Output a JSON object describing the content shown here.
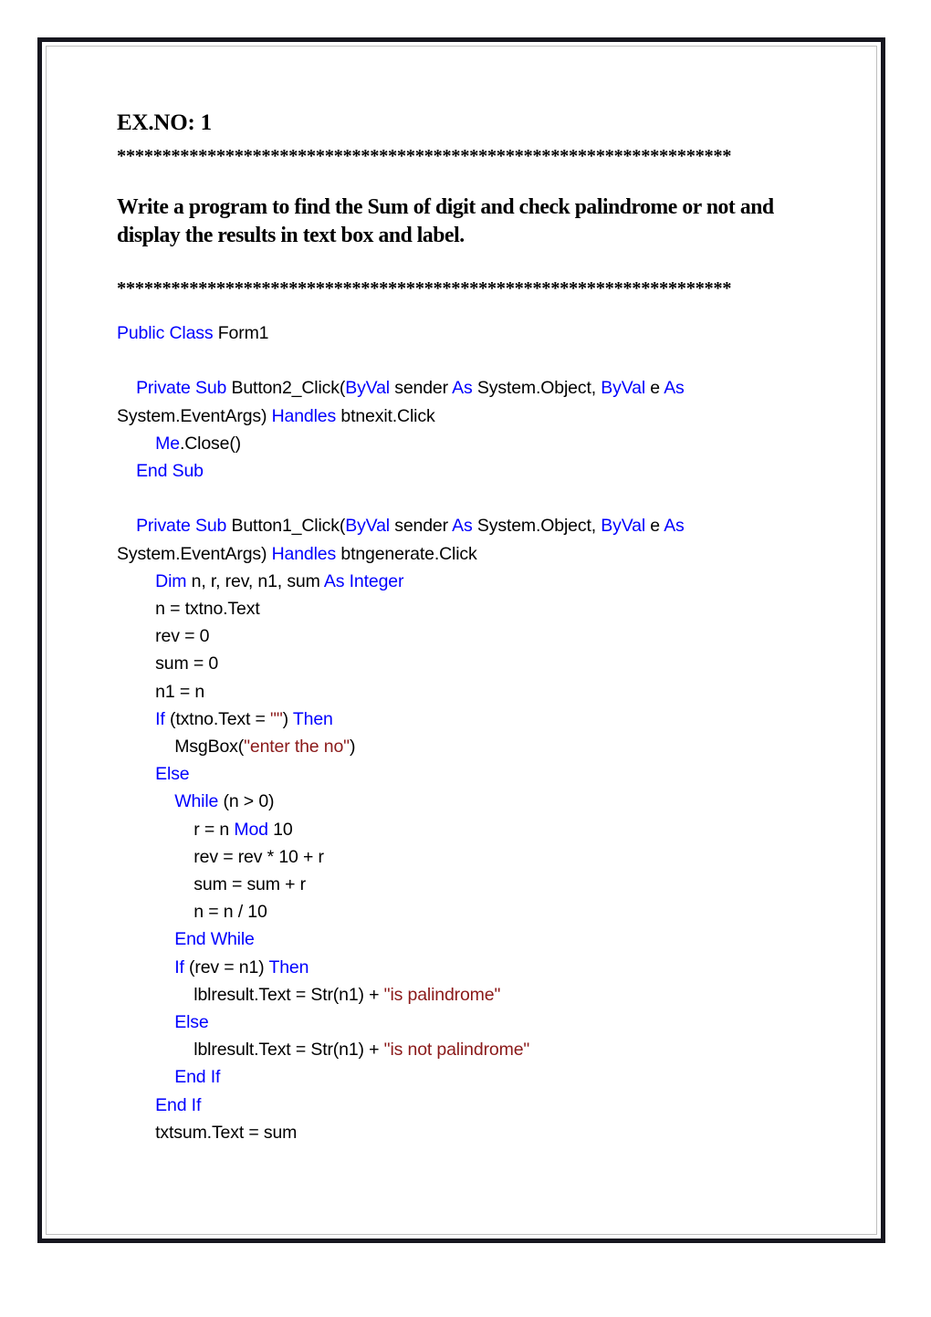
{
  "document": {
    "exno_label": "EX.NO: 1",
    "separator_line": "********************************************************************",
    "title": "Write a program to find the Sum of digit and check palindrome or not and display the results in text box and label.",
    "colors": {
      "keyword": "#0000FF",
      "string": "#8B1A1A",
      "plain": "#000000",
      "border": "#16161F",
      "inner_border": "#BFBFBF",
      "page_background": "#FFFFFF"
    },
    "language": "VB.NET"
  },
  "code_lines": [
    {
      "indent": 0,
      "tokens": [
        {
          "t": "Public Class",
          "c": "kw"
        },
        {
          "t": " Form1",
          "c": "pl"
        }
      ]
    },
    {
      "indent": 0,
      "tokens": []
    },
    {
      "indent": 1,
      "tokens": [
        {
          "t": "Private Sub",
          "c": "kw"
        },
        {
          "t": " Button2_Click(",
          "c": "pl"
        },
        {
          "t": "ByVal",
          "c": "kw"
        },
        {
          "t": " sender ",
          "c": "pl"
        },
        {
          "t": "As",
          "c": "kw"
        },
        {
          "t": " System.Object, ",
          "c": "pl"
        },
        {
          "t": "ByVal",
          "c": "kw"
        },
        {
          "t": " e ",
          "c": "pl"
        },
        {
          "t": "As",
          "c": "kw"
        },
        {
          "t": " System.EventArgs) ",
          "c": "pl"
        },
        {
          "t": "Handles",
          "c": "kw"
        },
        {
          "t": " btnexit.Click",
          "c": "pl"
        }
      ]
    },
    {
      "indent": 2,
      "tokens": [
        {
          "t": "Me",
          "c": "kw"
        },
        {
          "t": ".Close()",
          "c": "pl"
        }
      ]
    },
    {
      "indent": 1,
      "tokens": [
        {
          "t": "End Sub",
          "c": "kw"
        }
      ]
    },
    {
      "indent": 0,
      "tokens": []
    },
    {
      "indent": 1,
      "tokens": [
        {
          "t": "Private Sub",
          "c": "kw"
        },
        {
          "t": " Button1_Click(",
          "c": "pl"
        },
        {
          "t": "ByVal",
          "c": "kw"
        },
        {
          "t": " sender ",
          "c": "pl"
        },
        {
          "t": "As",
          "c": "kw"
        },
        {
          "t": " System.Object, ",
          "c": "pl"
        },
        {
          "t": "ByVal",
          "c": "kw"
        },
        {
          "t": " e ",
          "c": "pl"
        },
        {
          "t": "As",
          "c": "kw"
        },
        {
          "t": " System.EventArgs) ",
          "c": "pl"
        },
        {
          "t": "Handles",
          "c": "kw"
        },
        {
          "t": " btngenerate.Click",
          "c": "pl"
        }
      ]
    },
    {
      "indent": 2,
      "tokens": [
        {
          "t": "Dim",
          "c": "kw"
        },
        {
          "t": " n, r, rev, n1, sum ",
          "c": "pl"
        },
        {
          "t": "As Integer",
          "c": "kw"
        }
      ]
    },
    {
      "indent": 2,
      "tokens": [
        {
          "t": "n = txtno.Text",
          "c": "pl"
        }
      ]
    },
    {
      "indent": 2,
      "tokens": [
        {
          "t": "rev = 0",
          "c": "pl"
        }
      ]
    },
    {
      "indent": 2,
      "tokens": [
        {
          "t": "sum = 0",
          "c": "pl"
        }
      ]
    },
    {
      "indent": 2,
      "tokens": [
        {
          "t": "n1 = n",
          "c": "pl"
        }
      ]
    },
    {
      "indent": 2,
      "tokens": [
        {
          "t": "If",
          "c": "kw"
        },
        {
          "t": " (txtno.Text = ",
          "c": "pl"
        },
        {
          "t": "\"\"",
          "c": "str"
        },
        {
          "t": ") ",
          "c": "pl"
        },
        {
          "t": "Then",
          "c": "kw"
        }
      ]
    },
    {
      "indent": 3,
      "tokens": [
        {
          "t": "MsgBox(",
          "c": "pl"
        },
        {
          "t": "\"enter the no\"",
          "c": "str"
        },
        {
          "t": ")",
          "c": "pl"
        }
      ]
    },
    {
      "indent": 2,
      "tokens": [
        {
          "t": "Else",
          "c": "kw"
        }
      ]
    },
    {
      "indent": 3,
      "tokens": [
        {
          "t": "While",
          "c": "kw"
        },
        {
          "t": " (n > 0)",
          "c": "pl"
        }
      ]
    },
    {
      "indent": 4,
      "tokens": [
        {
          "t": "r = n ",
          "c": "pl"
        },
        {
          "t": "Mod",
          "c": "kw"
        },
        {
          "t": " 10",
          "c": "pl"
        }
      ]
    },
    {
      "indent": 4,
      "tokens": [
        {
          "t": "rev = rev * 10 + r",
          "c": "pl"
        }
      ]
    },
    {
      "indent": 4,
      "tokens": [
        {
          "t": "sum = sum + r",
          "c": "pl"
        }
      ]
    },
    {
      "indent": 4,
      "tokens": [
        {
          "t": "n = n / 10",
          "c": "pl"
        }
      ]
    },
    {
      "indent": 3,
      "tokens": [
        {
          "t": "End While",
          "c": "kw"
        }
      ]
    },
    {
      "indent": 3,
      "tokens": [
        {
          "t": "If",
          "c": "kw"
        },
        {
          "t": " (rev = n1) ",
          "c": "pl"
        },
        {
          "t": "Then",
          "c": "kw"
        }
      ]
    },
    {
      "indent": 4,
      "tokens": [
        {
          "t": "lblresult.Text = Str(n1) + ",
          "c": "pl"
        },
        {
          "t": "\"is palindrome\"",
          "c": "str"
        }
      ]
    },
    {
      "indent": 3,
      "tokens": [
        {
          "t": "Else",
          "c": "kw"
        }
      ]
    },
    {
      "indent": 4,
      "tokens": [
        {
          "t": "lblresult.Text = Str(n1) + ",
          "c": "pl"
        },
        {
          "t": "\"is not palindrome\"",
          "c": "str"
        }
      ]
    },
    {
      "indent": 3,
      "tokens": [
        {
          "t": "End If",
          "c": "kw"
        }
      ]
    },
    {
      "indent": 2,
      "tokens": [
        {
          "t": "End If",
          "c": "kw"
        }
      ]
    },
    {
      "indent": 2,
      "tokens": [
        {
          "t": "txtsum.Text = sum",
          "c": "pl"
        }
      ]
    }
  ]
}
